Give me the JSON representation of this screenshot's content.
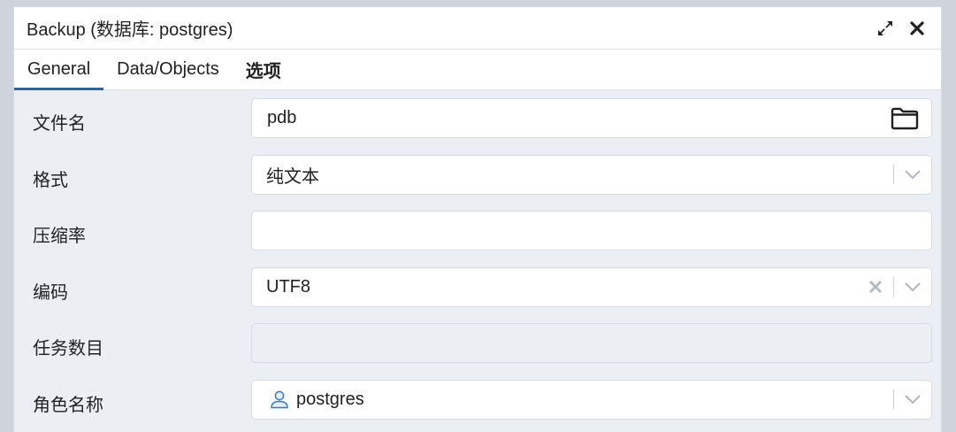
{
  "dialog": {
    "title": "Backup (数据库: postgres)",
    "expand_icon": "expand-arrows-icon",
    "close_icon": "close-icon"
  },
  "tabs": [
    {
      "label": "General",
      "active": true
    },
    {
      "label": "Data/Objects",
      "active": false
    },
    {
      "label": "选项",
      "active": false
    }
  ],
  "form": {
    "filename": {
      "label": "文件名",
      "value": "pdb",
      "icon": "folder-icon"
    },
    "format": {
      "label": "格式",
      "value": "纯文本"
    },
    "compression": {
      "label": "压缩率",
      "value": ""
    },
    "encoding": {
      "label": "编码",
      "value": "UTF8"
    },
    "jobs": {
      "label": "任务数目",
      "value": ""
    },
    "role": {
      "label": "角色名称",
      "value": "postgres",
      "icon": "user-icon"
    }
  },
  "colors": {
    "accent": "#326690",
    "background": "#ebeef3"
  }
}
